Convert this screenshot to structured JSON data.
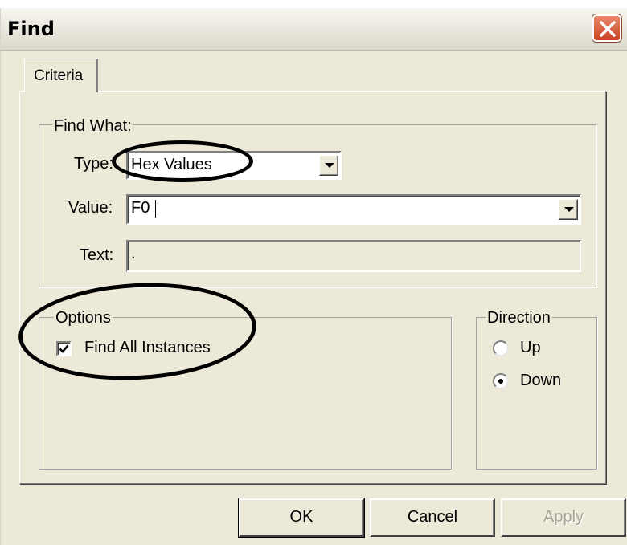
{
  "window": {
    "title": "Find"
  },
  "tabs": [
    {
      "label": "Criteria"
    }
  ],
  "find_what": {
    "legend": "Find What:",
    "type_label": "Type:",
    "type_value": "Hex Values",
    "value_label": "Value:",
    "value_value": "F0",
    "text_label": "Text:",
    "text_value": "."
  },
  "options": {
    "legend": "Options",
    "find_all_label": "Find All Instances",
    "find_all_checked": true
  },
  "direction": {
    "legend": "Direction",
    "up_label": "Up",
    "down_label": "Down",
    "selected": "Down"
  },
  "buttons": {
    "ok": "OK",
    "cancel": "Cancel",
    "apply": "Apply"
  },
  "colors": {
    "dialog_bg": "#ECE9D8",
    "close_button": "#C8421F",
    "annotation": "#000000"
  }
}
